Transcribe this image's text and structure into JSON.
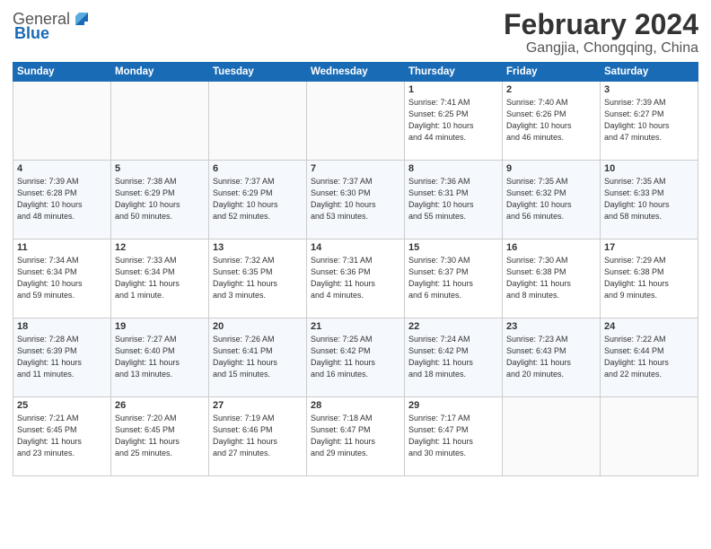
{
  "header": {
    "logo_general": "General",
    "logo_blue": "Blue",
    "title": "February 2024",
    "subtitle": "Gangjia, Chongqing, China"
  },
  "weekdays": [
    "Sunday",
    "Monday",
    "Tuesday",
    "Wednesday",
    "Thursday",
    "Friday",
    "Saturday"
  ],
  "weeks": [
    [
      {
        "day": "",
        "info": ""
      },
      {
        "day": "",
        "info": ""
      },
      {
        "day": "",
        "info": ""
      },
      {
        "day": "",
        "info": ""
      },
      {
        "day": "1",
        "info": "Sunrise: 7:41 AM\nSunset: 6:25 PM\nDaylight: 10 hours\nand 44 minutes."
      },
      {
        "day": "2",
        "info": "Sunrise: 7:40 AM\nSunset: 6:26 PM\nDaylight: 10 hours\nand 46 minutes."
      },
      {
        "day": "3",
        "info": "Sunrise: 7:39 AM\nSunset: 6:27 PM\nDaylight: 10 hours\nand 47 minutes."
      }
    ],
    [
      {
        "day": "4",
        "info": "Sunrise: 7:39 AM\nSunset: 6:28 PM\nDaylight: 10 hours\nand 48 minutes."
      },
      {
        "day": "5",
        "info": "Sunrise: 7:38 AM\nSunset: 6:29 PM\nDaylight: 10 hours\nand 50 minutes."
      },
      {
        "day": "6",
        "info": "Sunrise: 7:37 AM\nSunset: 6:29 PM\nDaylight: 10 hours\nand 52 minutes."
      },
      {
        "day": "7",
        "info": "Sunrise: 7:37 AM\nSunset: 6:30 PM\nDaylight: 10 hours\nand 53 minutes."
      },
      {
        "day": "8",
        "info": "Sunrise: 7:36 AM\nSunset: 6:31 PM\nDaylight: 10 hours\nand 55 minutes."
      },
      {
        "day": "9",
        "info": "Sunrise: 7:35 AM\nSunset: 6:32 PM\nDaylight: 10 hours\nand 56 minutes."
      },
      {
        "day": "10",
        "info": "Sunrise: 7:35 AM\nSunset: 6:33 PM\nDaylight: 10 hours\nand 58 minutes."
      }
    ],
    [
      {
        "day": "11",
        "info": "Sunrise: 7:34 AM\nSunset: 6:34 PM\nDaylight: 10 hours\nand 59 minutes."
      },
      {
        "day": "12",
        "info": "Sunrise: 7:33 AM\nSunset: 6:34 PM\nDaylight: 11 hours\nand 1 minute."
      },
      {
        "day": "13",
        "info": "Sunrise: 7:32 AM\nSunset: 6:35 PM\nDaylight: 11 hours\nand 3 minutes."
      },
      {
        "day": "14",
        "info": "Sunrise: 7:31 AM\nSunset: 6:36 PM\nDaylight: 11 hours\nand 4 minutes."
      },
      {
        "day": "15",
        "info": "Sunrise: 7:30 AM\nSunset: 6:37 PM\nDaylight: 11 hours\nand 6 minutes."
      },
      {
        "day": "16",
        "info": "Sunrise: 7:30 AM\nSunset: 6:38 PM\nDaylight: 11 hours\nand 8 minutes."
      },
      {
        "day": "17",
        "info": "Sunrise: 7:29 AM\nSunset: 6:38 PM\nDaylight: 11 hours\nand 9 minutes."
      }
    ],
    [
      {
        "day": "18",
        "info": "Sunrise: 7:28 AM\nSunset: 6:39 PM\nDaylight: 11 hours\nand 11 minutes."
      },
      {
        "day": "19",
        "info": "Sunrise: 7:27 AM\nSunset: 6:40 PM\nDaylight: 11 hours\nand 13 minutes."
      },
      {
        "day": "20",
        "info": "Sunrise: 7:26 AM\nSunset: 6:41 PM\nDaylight: 11 hours\nand 15 minutes."
      },
      {
        "day": "21",
        "info": "Sunrise: 7:25 AM\nSunset: 6:42 PM\nDaylight: 11 hours\nand 16 minutes."
      },
      {
        "day": "22",
        "info": "Sunrise: 7:24 AM\nSunset: 6:42 PM\nDaylight: 11 hours\nand 18 minutes."
      },
      {
        "day": "23",
        "info": "Sunrise: 7:23 AM\nSunset: 6:43 PM\nDaylight: 11 hours\nand 20 minutes."
      },
      {
        "day": "24",
        "info": "Sunrise: 7:22 AM\nSunset: 6:44 PM\nDaylight: 11 hours\nand 22 minutes."
      }
    ],
    [
      {
        "day": "25",
        "info": "Sunrise: 7:21 AM\nSunset: 6:45 PM\nDaylight: 11 hours\nand 23 minutes."
      },
      {
        "day": "26",
        "info": "Sunrise: 7:20 AM\nSunset: 6:45 PM\nDaylight: 11 hours\nand 25 minutes."
      },
      {
        "day": "27",
        "info": "Sunrise: 7:19 AM\nSunset: 6:46 PM\nDaylight: 11 hours\nand 27 minutes."
      },
      {
        "day": "28",
        "info": "Sunrise: 7:18 AM\nSunset: 6:47 PM\nDaylight: 11 hours\nand 29 minutes."
      },
      {
        "day": "29",
        "info": "Sunrise: 7:17 AM\nSunset: 6:47 PM\nDaylight: 11 hours\nand 30 minutes."
      },
      {
        "day": "",
        "info": ""
      },
      {
        "day": "",
        "info": ""
      }
    ]
  ]
}
